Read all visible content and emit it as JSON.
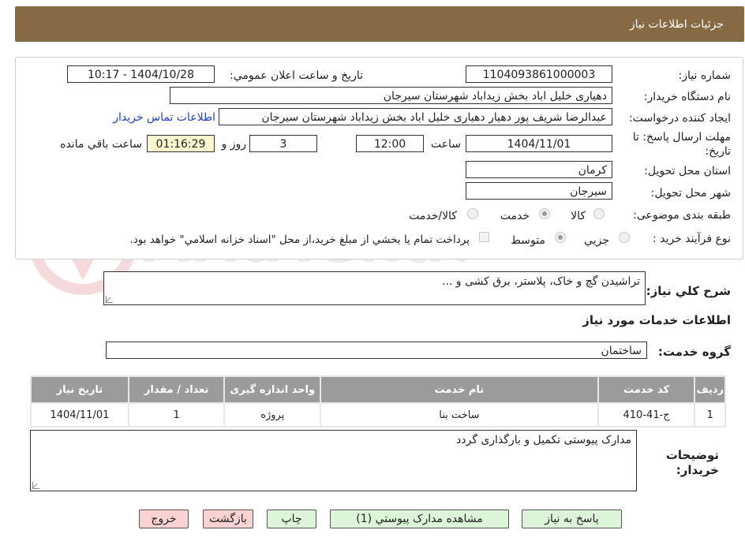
{
  "header": {
    "title": "جزئيات اطلاعات نياز"
  },
  "form": {
    "need_number": {
      "label": "شماره نياز:",
      "value": "1104093861000003"
    },
    "announce_datetime": {
      "label": "تاريخ و ساعت اعلان عمومي:",
      "value": "1404/10/28 - 10:17"
    },
    "buyer_org": {
      "label": "نام دستگاه خريدار:",
      "value": "دهیاری خلیل اباد بخش زیداباد شهرستان سیرجان"
    },
    "requester": {
      "label": "ايجاد کننده درخواست:",
      "value": "عبدالرضا شریف پور دهیار دهیاری خلیل اباد بخش زیداباد شهرستان سیرجان",
      "contact_link": "اطلاعات تماس خريدار"
    },
    "deadline": {
      "label_line1": "مهلت ارسال پاسخ: تا",
      "label_line2": "تاريخ:",
      "date": "1404/11/01",
      "time_label": "ساعت",
      "time": "12:00",
      "days": "3",
      "days_label": "روز و",
      "remaining": "01:16:29",
      "remaining_label": "ساعت باقي مانده"
    },
    "province": {
      "label": "استان محل تحويل:",
      "value": "کرمان"
    },
    "city": {
      "label": "شهر محل تحويل:",
      "value": "سیرجان"
    },
    "category": {
      "label": "طبقه بندی موضوعی:",
      "options": [
        "کالا",
        "خدمت",
        "کالا/خدمت"
      ],
      "selected": "خدمت"
    },
    "purchase_type": {
      "label": "نوع فرآيند خريد :",
      "options": [
        "جزيي",
        "متوسط"
      ],
      "selected": "متوسط",
      "note": "پرداخت تمام يا بخشي از مبلغ خريد،از محل \"اسناد خزانه اسلامي\" خواهد بود."
    }
  },
  "description": {
    "label": "شرح کلي نياز:",
    "value": "تراشیدن گچ و خاک، پلاستر، برق کشی و ..."
  },
  "services": {
    "section_title": "اطلاعات خدمات مورد نياز",
    "group_label": "گروه خدمت:",
    "group_value": "ساختمان",
    "columns": [
      "رديف",
      "کد خدمت",
      "نام خدمت",
      "واحد اندازه گيری",
      "تعداد / مقدار",
      "تاريخ نياز"
    ],
    "rows": [
      [
        "1",
        "ج-41-410",
        "ساخت بنا",
        "پروژه",
        "1",
        "1404/11/01"
      ]
    ]
  },
  "buyer_notes": {
    "label_line1": "توضيحات",
    "label_line2": "خريدار:",
    "value": "مدارک پیوستی تکمیل و بارگذاری گردد"
  },
  "buttons": {
    "reply": "پاسخ به نياز",
    "attachments": "مشاهده مدارک پيوستي (1)",
    "print": "چاپ",
    "back": "بازگشت",
    "exit": "خروج"
  },
  "watermark": {
    "text": "AriaTender.neT"
  },
  "colors": {
    "header": "#876a43",
    "table_header": "#9b9b9b",
    "button_green": "#dcf5d8",
    "button_red": "#fbd2d2",
    "link": "#1b3fcc"
  }
}
